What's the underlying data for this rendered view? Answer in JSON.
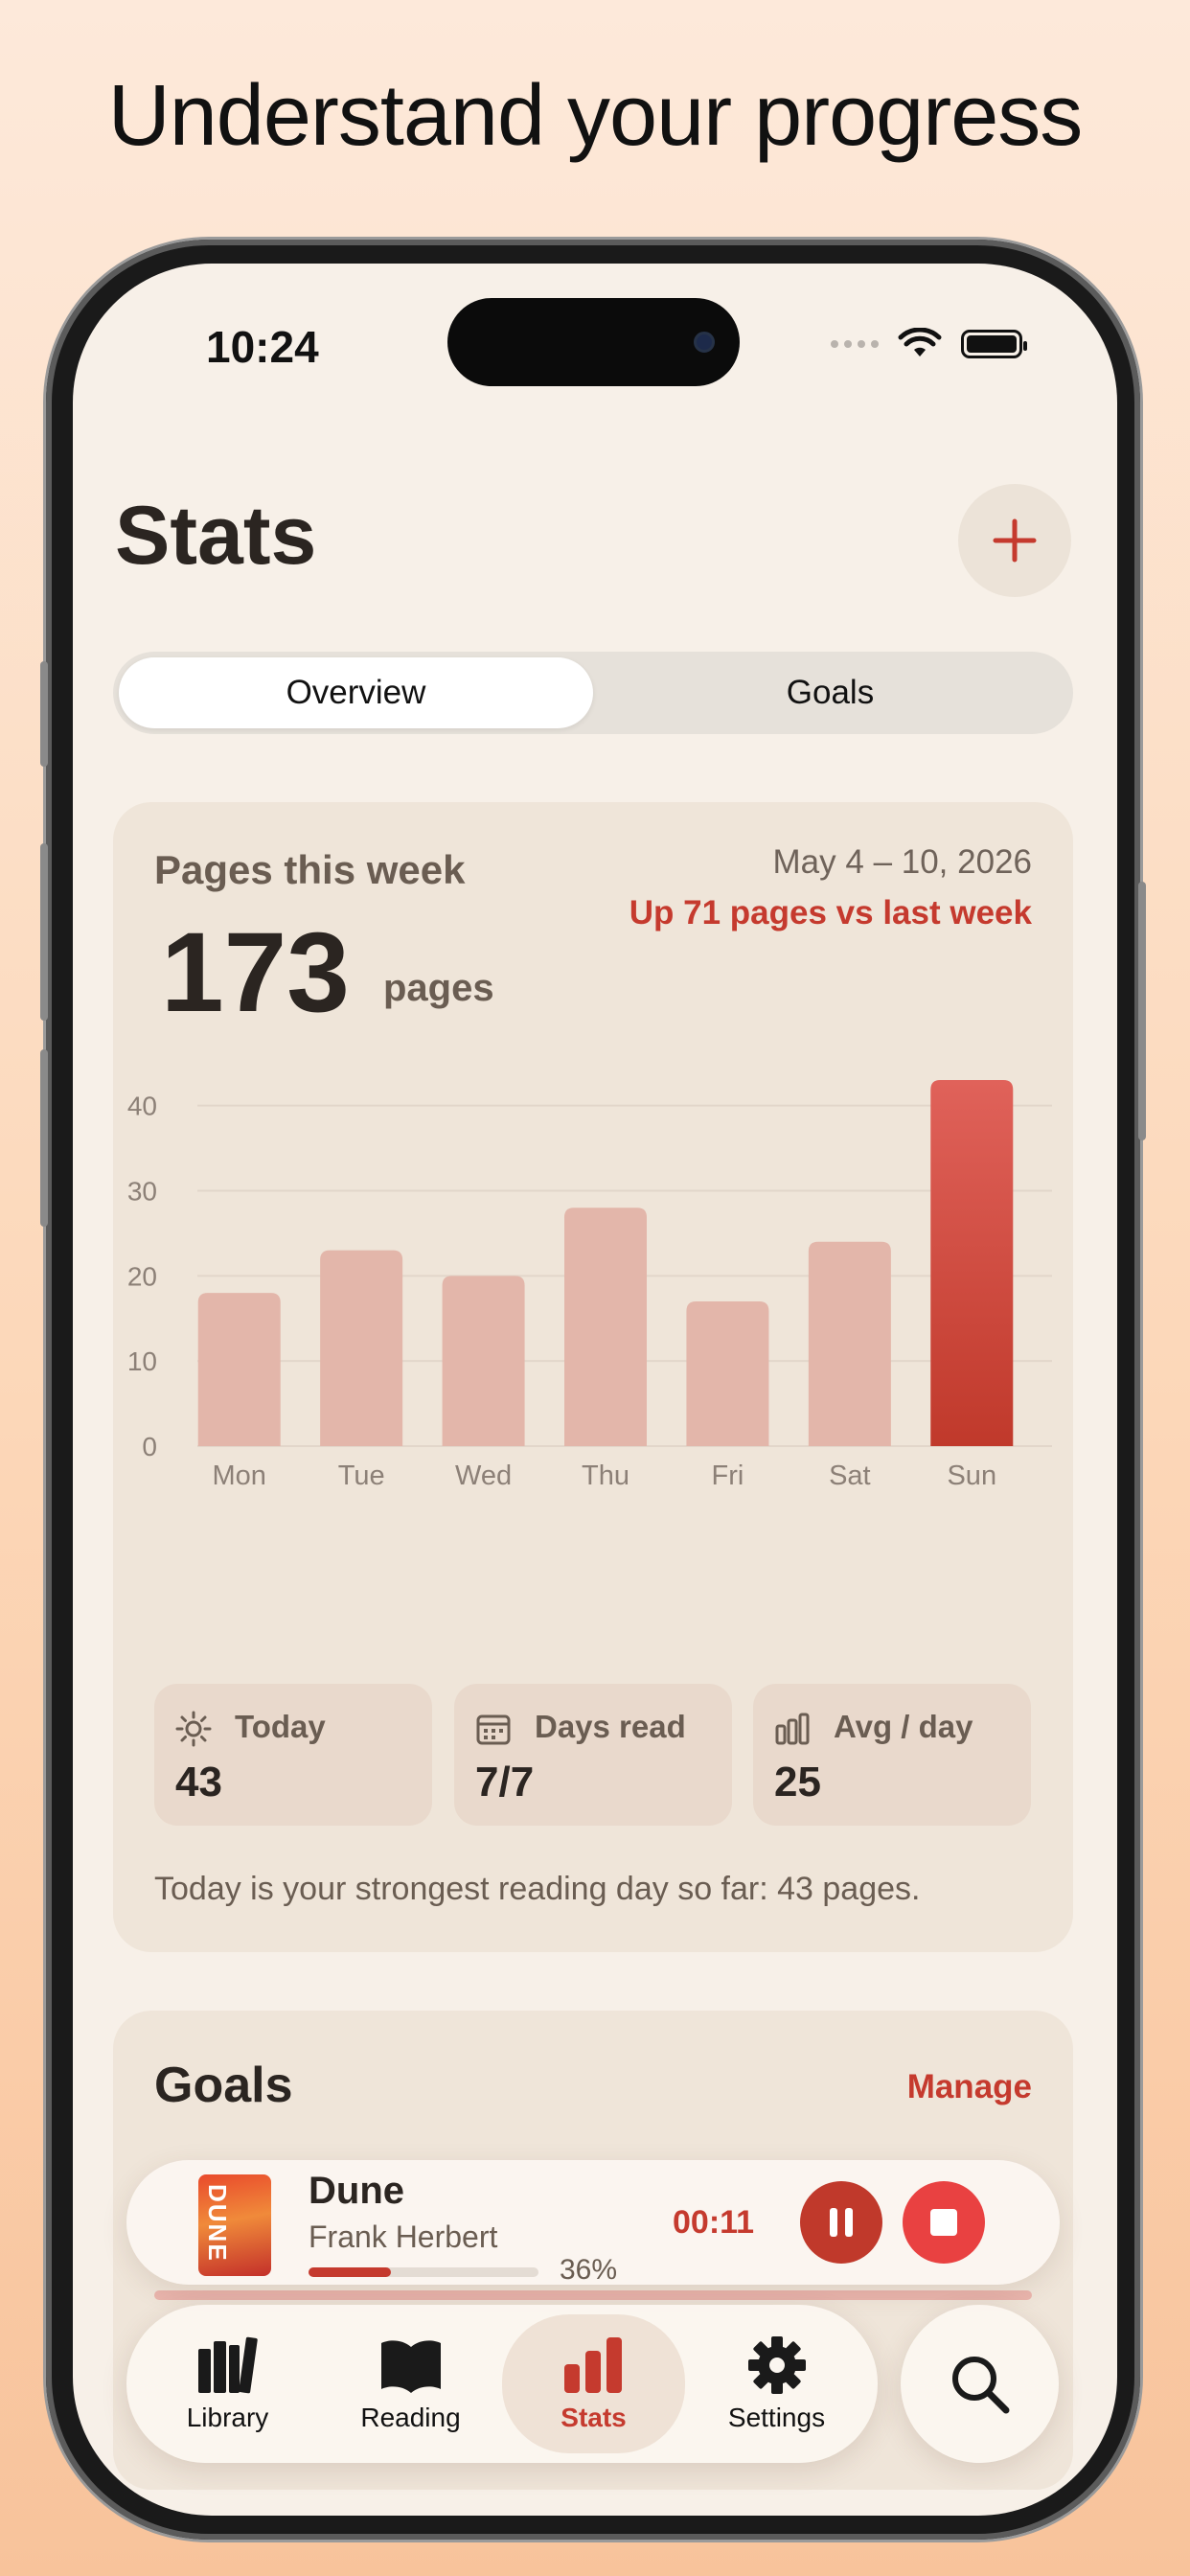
{
  "headline": "Understand your progress",
  "status_bar": {
    "time": "10:24"
  },
  "page": {
    "title": "Stats"
  },
  "segmented": {
    "overview": "Overview",
    "goals": "Goals"
  },
  "weekly_card": {
    "label": "Pages this week",
    "date_range": "May 4 – 10, 2026",
    "trend": "Up 71 pages vs last week",
    "total": "173",
    "unit": "pages",
    "note": "Today is your strongest reading day so far: 43 pages."
  },
  "chart_data": {
    "type": "bar",
    "categories": [
      "Mon",
      "Tue",
      "Wed",
      "Thu",
      "Fri",
      "Sat",
      "Sun"
    ],
    "values": [
      18,
      23,
      20,
      28,
      17,
      24,
      43
    ],
    "highlight_index": 6,
    "ylim": [
      0,
      43
    ],
    "yticks": [
      0,
      10,
      20,
      30,
      40
    ],
    "grid": true,
    "colors": {
      "bar": "#e3b6aa",
      "highlight_top": "#e0625a",
      "highlight_bottom": "#c0392b",
      "grid": "#e2d6ca",
      "tick": "#8c8077"
    }
  },
  "stats": [
    {
      "icon": "sun-icon",
      "label": "Today",
      "value": "43"
    },
    {
      "icon": "calendar-icon",
      "label": "Days read",
      "value": "7/7"
    },
    {
      "icon": "bars-icon",
      "label": "Avg / day",
      "value": "25"
    }
  ],
  "goals_card": {
    "title": "Goals",
    "manage": "Manage"
  },
  "now_playing": {
    "title": "Dune",
    "author": "Frank Herbert",
    "progress": 36,
    "progress_label": "36%",
    "timer": "00:11",
    "cover_text": "DUNE"
  },
  "tabs": [
    {
      "label": "Library",
      "icon": "library-icon",
      "active": false
    },
    {
      "label": "Reading",
      "icon": "book-open-icon",
      "active": false
    },
    {
      "label": "Stats",
      "icon": "stats-icon",
      "active": true
    },
    {
      "label": "Settings",
      "icon": "gear-icon",
      "active": false
    }
  ],
  "colors": {
    "accent": "#c53a2e",
    "background": "#f7f0e8",
    "card": "#efe5d9"
  }
}
